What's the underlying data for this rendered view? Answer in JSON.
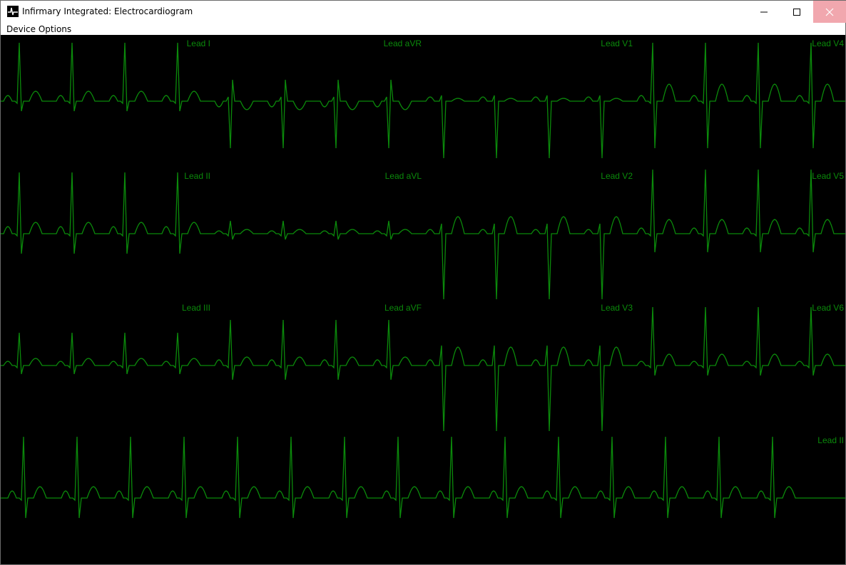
{
  "window": {
    "title": "Infirmary Integrated: Electrocardiogram",
    "icon": "ecg-app-icon",
    "controls": [
      "minimize-icon",
      "maximize-icon",
      "close-icon"
    ],
    "close_hover_color": "#f1a7ae"
  },
  "menu": {
    "items": [
      {
        "label": "Device Options"
      }
    ]
  },
  "ecg": {
    "trace_color": "#0b8a0b",
    "background": "#000000",
    "rows": [
      [
        {
          "label": "Lead I",
          "type": "lead1"
        },
        {
          "label": "Lead aVR",
          "type": "aVR"
        },
        {
          "label": "Lead V1",
          "type": "V1"
        },
        {
          "label": "Lead V4",
          "type": "V4"
        }
      ],
      [
        {
          "label": "Lead II",
          "type": "lead2"
        },
        {
          "label": "Lead aVL",
          "type": "aVL"
        },
        {
          "label": "Lead V2",
          "type": "V2"
        },
        {
          "label": "Lead V5",
          "type": "V5"
        }
      ],
      [
        {
          "label": "Lead III",
          "type": "lead3"
        },
        {
          "label": "Lead aVF",
          "type": "aVF"
        },
        {
          "label": "Lead V3",
          "type": "V3"
        },
        {
          "label": "Lead V6",
          "type": "V6"
        }
      ]
    ],
    "rhythm_strip": {
      "label": "Lead II",
      "type": "lead2"
    }
  }
}
